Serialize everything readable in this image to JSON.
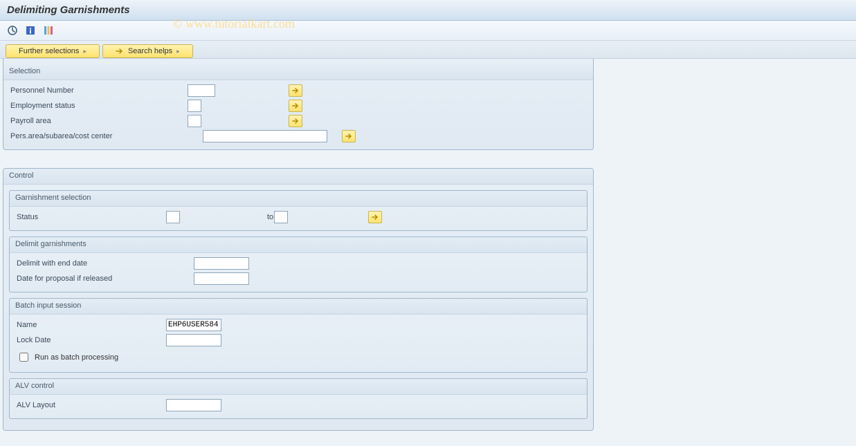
{
  "title": "Delimiting Garnishments",
  "watermark": "© www.tutorialkart.com",
  "toolbar": {
    "icons": [
      "execute-icon",
      "info-icon",
      "variant-icon"
    ]
  },
  "tabs": {
    "further_selections": "Further selections",
    "search_helps": "Search helps"
  },
  "groups": {
    "selection": {
      "legend": "Selection",
      "personnel_number_label": "Personnel Number",
      "personnel_number_value": "",
      "employment_status_label": "Employment status",
      "employment_status_value": "",
      "payroll_area_label": "Payroll area",
      "payroll_area_value": "",
      "pers_area_label": "Pers.area/subarea/cost center",
      "pers_area_value": ""
    },
    "control": {
      "legend": "Control",
      "garnishment_selection": {
        "legend": "Garnishment selection",
        "status_label": "Status",
        "status_from": "",
        "status_to_label": "to",
        "status_to": ""
      },
      "delimit_garnishments": {
        "legend": "Delimit garnishments",
        "delimit_end_date_label": "Delimit with end date",
        "delimit_end_date_value": "",
        "date_proposal_label": "Date for proposal if released",
        "date_proposal_value": ""
      },
      "batch_input_session": {
        "legend": "Batch input session",
        "name_label": "Name",
        "name_value": "EHP6USER584",
        "lock_date_label": "Lock Date",
        "lock_date_value": "",
        "run_batch_label": "Run as batch processing",
        "run_batch_checked": false
      },
      "alv_control": {
        "legend": "ALV control",
        "alv_layout_label": "ALV Layout",
        "alv_layout_value": ""
      }
    }
  }
}
